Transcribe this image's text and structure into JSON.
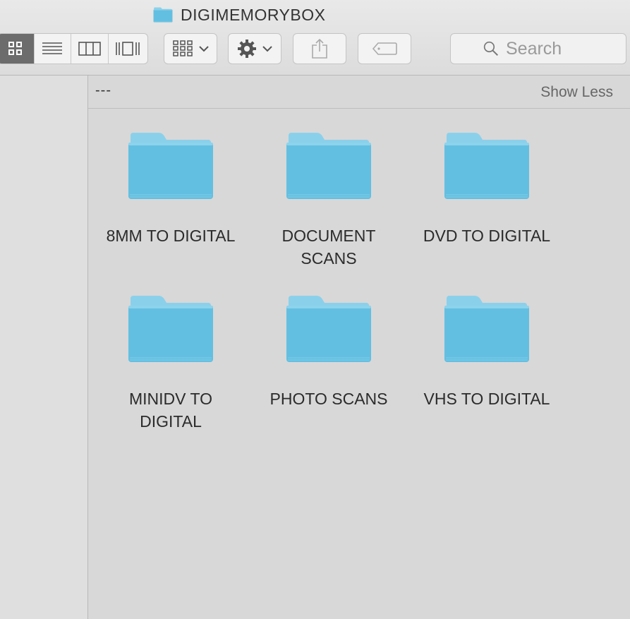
{
  "window": {
    "title": "DIGIMEMORYBOX"
  },
  "toolbar": {
    "view_modes": [
      {
        "name": "icon-view",
        "icon": "grid-icon",
        "active": true
      },
      {
        "name": "list-view",
        "icon": "list-icon",
        "active": false
      },
      {
        "name": "column-view",
        "icon": "columns-icon",
        "active": false
      },
      {
        "name": "cover-flow-view",
        "icon": "cover-flow-icon",
        "active": false
      }
    ],
    "arrange_icon": "arrange-grid-icon",
    "action_icon": "gear-icon",
    "share_icon": "share-icon",
    "tags_icon": "tag-icon",
    "search": {
      "placeholder": "Search",
      "value": ""
    }
  },
  "content": {
    "group_name": "---",
    "group_toggle": "Show Less",
    "items": [
      {
        "label": "8MM TO DIGITAL",
        "icon": "folder-icon"
      },
      {
        "label": "DOCUMENT SCANS",
        "icon": "folder-icon"
      },
      {
        "label": "DVD TO DIGITAL",
        "icon": "folder-icon"
      },
      {
        "label": "MINIDV TO DIGITAL",
        "icon": "folder-icon"
      },
      {
        "label": "PHOTO SCANS",
        "icon": "folder-icon"
      },
      {
        "label": "VHS TO DIGITAL",
        "icon": "folder-icon"
      }
    ]
  },
  "colors": {
    "folder": "#5fbde0",
    "folder_tab": "#7cc9e6",
    "active_view_bg": "#6c6c6c"
  }
}
